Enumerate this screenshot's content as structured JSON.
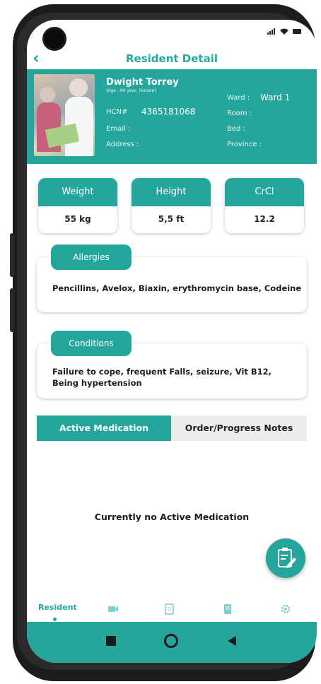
{
  "header": {
    "title": "Resident Detail"
  },
  "resident": {
    "name": "Dwight Torrey",
    "age_gender": "(Age : 90 year, Female)",
    "hcn_label": "HCN#",
    "hcn_value": "4365181068",
    "email_label": "Email :",
    "address_label": "Address :",
    "ward_label": "Ward :",
    "ward_value": "Ward 1",
    "room_label": "Room :",
    "bed_label": "Bed :",
    "province_label": "Province :"
  },
  "stats": [
    {
      "label": "Weight",
      "value": "55 kg"
    },
    {
      "label": "Height",
      "value": "5,5 ft"
    },
    {
      "label": "CrCl",
      "value": "12.2"
    }
  ],
  "allergies": {
    "label": "Allergies",
    "text": "Pencillins, Avelox, Biaxin, erythromycin base, Codeine"
  },
  "conditions": {
    "label": "Conditions",
    "line1": "Failure to cope, frequent Falls, seizure, Vit B12,",
    "line2": "Being hypertension"
  },
  "tabs": {
    "active": "Active Medication",
    "other": "Order/Progress Notes"
  },
  "empty_message": "Currently no Active Medication",
  "bottom_nav": {
    "active_label": "Resident",
    "icons": [
      "video-icon",
      "document-icon",
      "notes-icon",
      "settings-icon"
    ]
  },
  "colors": {
    "accent": "#24a69d",
    "text": "#1d1d1d"
  }
}
